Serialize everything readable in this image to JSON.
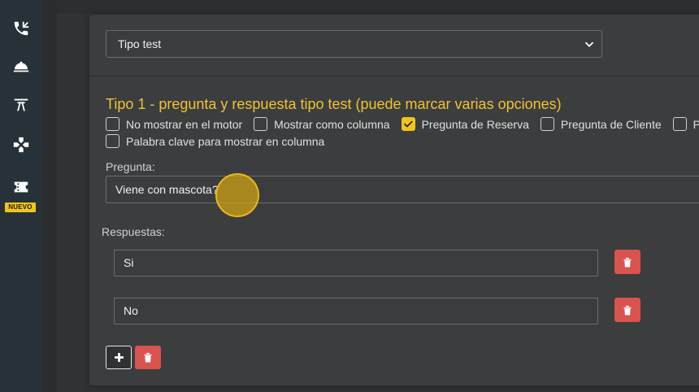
{
  "sidebar": {
    "items": [
      {
        "icon": "phone-transfer-icon"
      },
      {
        "icon": "service-bell-icon"
      },
      {
        "icon": "boarding-icon"
      },
      {
        "icon": "gamepad-icon"
      },
      {
        "icon": "ticket-icon",
        "badge": "NUEVO"
      }
    ]
  },
  "question_type_select": {
    "value": "Tipo test"
  },
  "section": {
    "title": "Tipo 1 - pregunta y respuesta tipo test (puede marcar varias opciones)",
    "options": [
      {
        "label": "No mostrar en el motor",
        "checked": false
      },
      {
        "label": "Mostrar como columna",
        "checked": false
      },
      {
        "label": "Pregunta de Reserva",
        "checked": true
      },
      {
        "label": "Pregunta de Cliente",
        "checked": false
      },
      {
        "label": "P",
        "checked": false
      },
      {
        "label": "Palabra clave para mostrar en columna",
        "checked": false
      }
    ]
  },
  "question": {
    "label": "Pregunta:",
    "value": "Viene con mascota?"
  },
  "answers": {
    "label": "Respuestas:",
    "items": [
      {
        "value": "Si"
      },
      {
        "value": "No"
      }
    ]
  },
  "colors": {
    "accent": "#f0c419",
    "danger": "#d9534f",
    "sidebar": "#263238",
    "card": "#3b3d3e"
  }
}
